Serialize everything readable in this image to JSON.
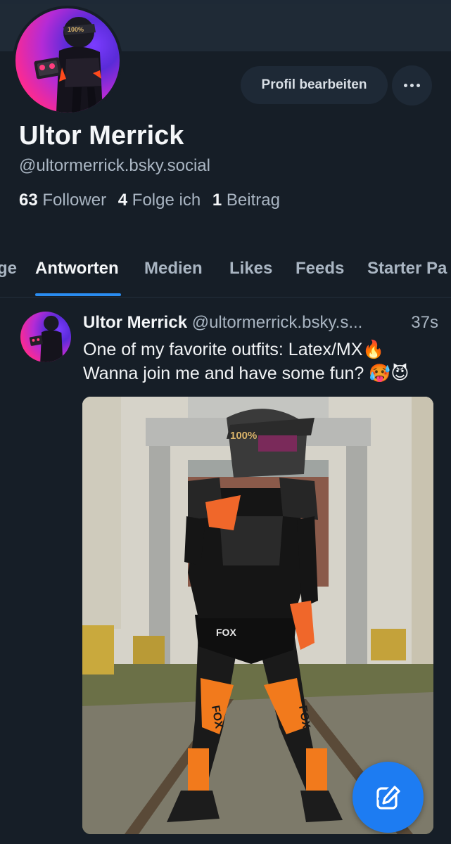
{
  "profile": {
    "display_name": "Ultor Merrick",
    "handle": "@ultormerrick.bsky.social",
    "edit_button": "Profil bearbeiten",
    "stats": {
      "followers_count": "63",
      "followers_label": "Follower",
      "following_count": "4",
      "following_label": "Folge ich",
      "posts_count": "1",
      "posts_label": "Beitrag"
    }
  },
  "tabs": [
    {
      "label": "ge"
    },
    {
      "label": "Antworten"
    },
    {
      "label": "Medien"
    },
    {
      "label": "Likes"
    },
    {
      "label": "Feeds"
    },
    {
      "label": "Starter Pa"
    }
  ],
  "post": {
    "author": "Ultor Merrick",
    "handle": "@ultormerrick.bsky.s...",
    "time": "37s",
    "line1": "One of my favorite outfits: Latex/MX🔥",
    "line2": "Wanna join me and have some fun? 🥵😈",
    "image_text_helmet": "100%",
    "image_text_leg_left": "FOX",
    "image_text_leg_right": "FOX",
    "image_text_shorts": "FOX"
  },
  "avatar_text": "100%",
  "colors": {
    "background": "#161e27",
    "accent": "#2a8cf0",
    "fab": "#1d7cf2",
    "muted_text": "#aab6c3"
  },
  "icons": {
    "more": "ellipsis-icon",
    "compose": "compose-icon"
  }
}
